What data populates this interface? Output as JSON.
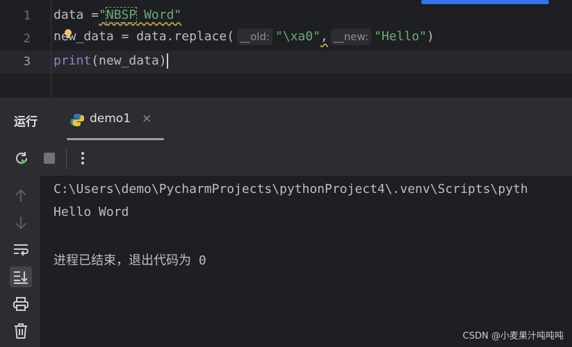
{
  "editor": {
    "line_numbers": [
      "1",
      "2",
      "3"
    ],
    "line1": {
      "var": "data =",
      "str": "\"NBSP Word\""
    },
    "line2": {
      "code": "new_data = data.replace(",
      "hint_old": "__old:",
      "arg1": "\"\\xa0\"",
      "comma": ",",
      "hint_new": "__new:",
      "arg2": "\"Hello\"",
      "close": ")"
    },
    "line3": {
      "fn": "print",
      "arg": "(new_data)"
    }
  },
  "run_panel": {
    "title": "运行",
    "tab_label": "demo1",
    "tab_close": "×"
  },
  "console": {
    "lines": [
      "C:\\Users\\demo\\PycharmProjects\\pythonProject4\\.venv\\Scripts\\pyth",
      "Hello Word",
      "",
      "进程已结束，退出代码为 0"
    ]
  },
  "watermark": "CSDN @小麦果汁吨吨吨",
  "colors": {
    "accent": "#3574f0",
    "string": "#6aab73",
    "builtin": "#8888c6",
    "background": "#1e1f22",
    "panel": "#2b2d30"
  }
}
